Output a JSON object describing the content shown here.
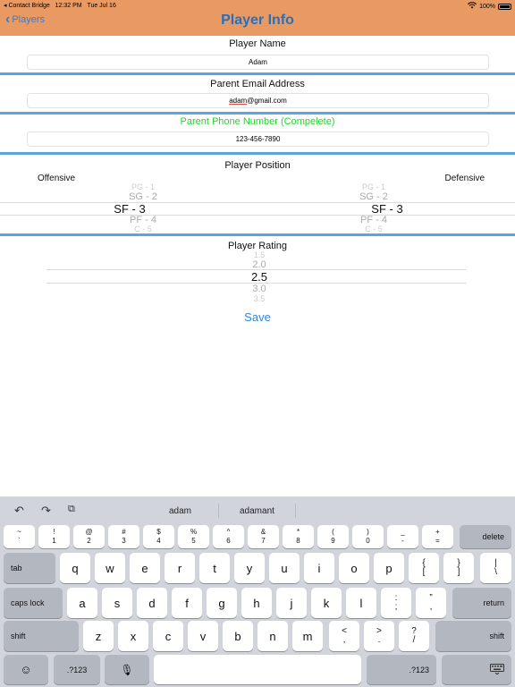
{
  "status": {
    "carrier": "◂ Contact Bridge",
    "time": "12:32 PM",
    "date": "Tue Jul 16",
    "battery": "100%"
  },
  "nav": {
    "back_label": "Players",
    "title": "Player Info"
  },
  "name_section": {
    "label": "Player Name",
    "value": "Adam"
  },
  "email_section": {
    "label": "Parent Email Address",
    "value_underlined": "adam",
    "value_rest": "@gmail.com"
  },
  "phone_section": {
    "label": "Parent Phone Number (Compelete)",
    "value": "123-456-7890",
    "label_color": "#22d62a"
  },
  "position_section": {
    "label": "Player Position",
    "offensive_label": "Offensive",
    "defensive_label": "Defensive",
    "offensive_items": [
      "PG - 1",
      "SG - 2",
      "SF - 3",
      "PF - 4",
      "C - 5"
    ],
    "offensive_selected": "SF - 3",
    "defensive_items": [
      "PG - 1",
      "SG - 2",
      "SF - 3",
      "PF - 4",
      "C - 5"
    ],
    "defensive_selected": "SF - 3"
  },
  "rating_section": {
    "label": "Player Rating",
    "items": [
      "1.5",
      "2.0",
      "2.5",
      "3.0",
      "3.5"
    ],
    "selected": "2.5"
  },
  "save_label": "Save",
  "keyboard": {
    "suggestions": [
      "adam",
      "adamant"
    ],
    "row1": [
      {
        "top": "~",
        "bottom": "`"
      },
      {
        "top": "!",
        "bottom": "1"
      },
      {
        "top": "@",
        "bottom": "2"
      },
      {
        "top": "#",
        "bottom": "3"
      },
      {
        "top": "$",
        "bottom": "4"
      },
      {
        "top": "%",
        "bottom": "5"
      },
      {
        "top": "^",
        "bottom": "6"
      },
      {
        "top": "&",
        "bottom": "7"
      },
      {
        "top": "*",
        "bottom": "8"
      },
      {
        "top": "(",
        "bottom": "9"
      },
      {
        "top": ")",
        "bottom": "0"
      },
      {
        "top": "_",
        "bottom": "-"
      },
      {
        "top": "+",
        "bottom": "="
      }
    ],
    "delete_label": "delete",
    "tab_label": "tab",
    "row2": [
      "q",
      "w",
      "e",
      "r",
      "t",
      "y",
      "u",
      "i",
      "o",
      "p"
    ],
    "row2_extra": [
      {
        "top": "{",
        "bottom": "["
      },
      {
        "top": "}",
        "bottom": "]"
      },
      {
        "top": "|",
        "bottom": "\\"
      }
    ],
    "caps_label": "caps lock",
    "row3": [
      "a",
      "s",
      "d",
      "f",
      "g",
      "h",
      "j",
      "k",
      "l"
    ],
    "row3_extra": [
      {
        "top": ":",
        "bottom": ";"
      },
      {
        "top": "”",
        "bottom": ","
      }
    ],
    "return_label": "return",
    "shift_label": "shift",
    "row4": [
      "z",
      "x",
      "c",
      "v",
      "b",
      "n",
      "m"
    ],
    "row4_extra": [
      {
        "top": "<",
        "bottom": ","
      },
      {
        "top": ">",
        "bottom": "."
      },
      {
        "top": "?",
        "bottom": "/"
      }
    ],
    "numbers_label": ".?123"
  }
}
